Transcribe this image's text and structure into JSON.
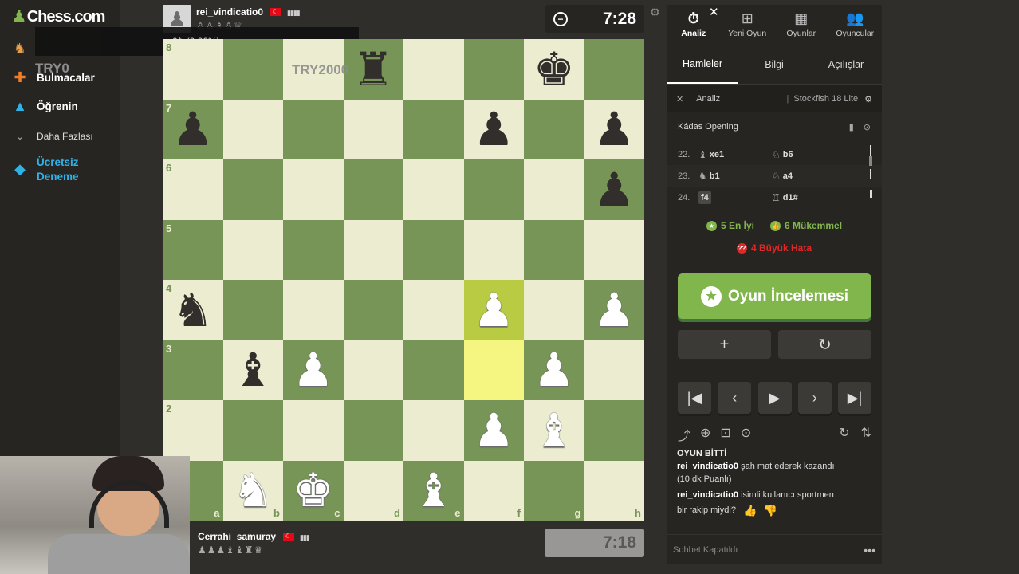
{
  "brand": {
    "name": "Chess.com"
  },
  "sidebar": {
    "items": [
      {
        "label": "",
        "icon": "knight-icon"
      },
      {
        "label": "Bulmacalar",
        "icon": "puzzle-icon"
      },
      {
        "label": "Öğrenin",
        "icon": "graduation-cap-icon"
      },
      {
        "label": "Daha Fazlası",
        "icon": "chevron-down-icon"
      },
      {
        "label": "Ücretsiz\nDeneme",
        "icon": "diamond-icon"
      }
    ]
  },
  "overlay": {
    "price_text": "0₺ (0.00%)",
    "try0": "TRY0",
    "try2000": "TRY2000"
  },
  "top_player": {
    "name": "rei_vindicatio0",
    "captured": "♙♙♗♙♕",
    "clock": "7:28"
  },
  "bottom_player": {
    "name": "Cerrahi_samuray",
    "captured": "♟♟♟♝♝♜♛",
    "clock": "7:18"
  },
  "board": {
    "ranks": [
      "8",
      "7",
      "6",
      "5",
      "4",
      "3",
      "2",
      "1"
    ],
    "files": [
      "a",
      "b",
      "c",
      "d",
      "e",
      "f",
      "g",
      "h"
    ],
    "rows": [
      [
        "",
        "",
        "",
        "br",
        "",
        "",
        "bk",
        ""
      ],
      [
        "bp",
        "",
        "",
        "",
        "",
        "bp",
        "",
        "bp"
      ],
      [
        "",
        "",
        "",
        "",
        "",
        "",
        "",
        "bp"
      ],
      [
        "",
        "",
        "",
        "",
        "",
        "",
        "",
        ""
      ],
      [
        "bn",
        "",
        "",
        "",
        "",
        "wp",
        "",
        "wp"
      ],
      [
        "",
        "bb",
        "wp",
        "",
        "",
        "",
        "wp",
        ""
      ],
      [
        "",
        "",
        "",
        "",
        "",
        "wp",
        "wb",
        ""
      ],
      [
        "",
        "wn",
        "wk",
        "",
        "wb",
        "",
        "",
        ""
      ]
    ],
    "highlight": [
      "f4",
      "f3"
    ]
  },
  "panel": {
    "top_tabs": [
      {
        "label": "Analiz",
        "icon": "stopwatch-icon"
      },
      {
        "label": "Yeni Oyun",
        "icon": "plus-square-icon"
      },
      {
        "label": "Oyunlar",
        "icon": "board-icon"
      },
      {
        "label": "Oyuncular",
        "icon": "players-icon"
      }
    ],
    "sub_tabs": [
      "Hamleler",
      "Bilgi",
      "Açılışlar"
    ],
    "engine": {
      "label": "Analiz",
      "name": "Stockfish 18 Lite"
    },
    "opening": "Kádas Opening",
    "moves": [
      {
        "num": "22.",
        "white": "xe1",
        "white_fig": "♝",
        "black": "b6",
        "black_fig": "♘"
      },
      {
        "num": "23.",
        "white": "b1",
        "white_fig": "♞",
        "black": "a4",
        "black_fig": "♘"
      },
      {
        "num": "24.",
        "white": "f4",
        "white_fig": "",
        "black": "d1#",
        "black_fig": "♖"
      }
    ],
    "stats": {
      "best": "5 En İyi",
      "excellent": "6 Mükemmel",
      "blunder": "4 Büyük Hata"
    },
    "review_button": "Oyun İncelemesi",
    "add_symbol": "+",
    "retry_symbol": "↻",
    "chat": {
      "game_over": "OYUN BİTTİ",
      "winner": "rei_vindicatio0",
      "result": "şah mat ederek kazandı",
      "rating": "(10 dk Puanlı)",
      "asker": "rei_vindicatio0",
      "question_part1": "isimli kullanıcı sportmen",
      "question_part2": "bir rakip miydi?"
    },
    "chat_closed": "Sohbet Kapatıldı"
  }
}
